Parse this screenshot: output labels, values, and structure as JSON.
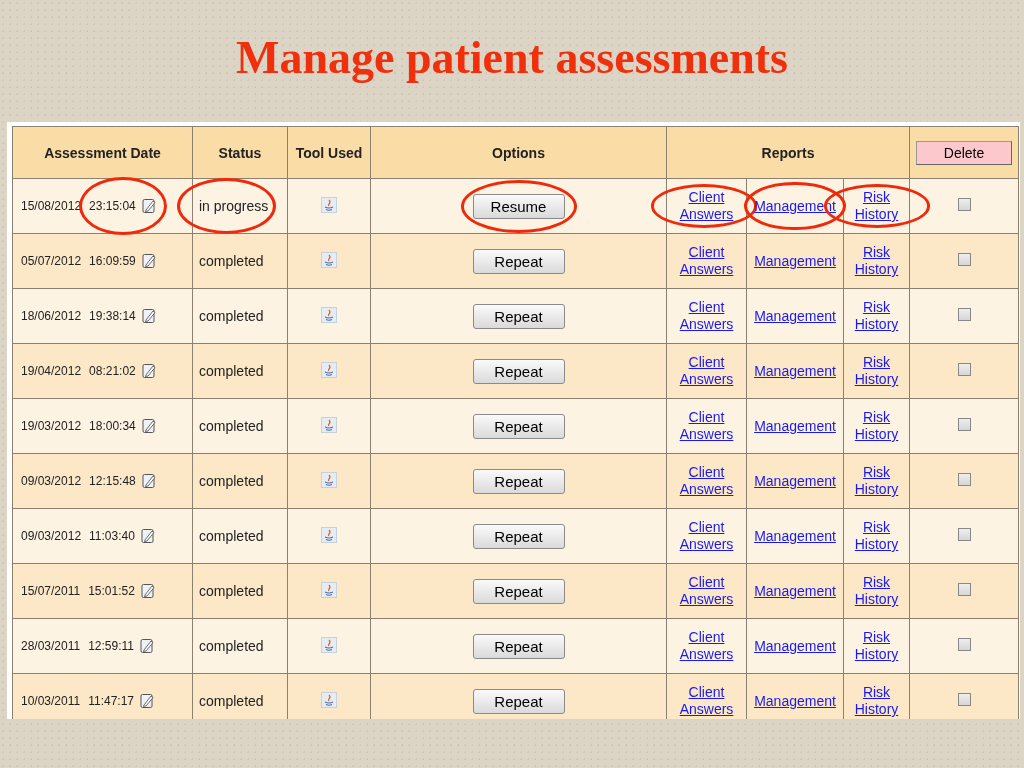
{
  "title": "Manage patient assessments",
  "columns": {
    "date": "Assessment Date",
    "status": "Status",
    "tool": "Tool Used",
    "options": "Options",
    "reports": "Reports",
    "delete": "Delete"
  },
  "rows": [
    {
      "date": "15/08/2012",
      "time": "23:15:04",
      "status": "in progress",
      "action": "Resume",
      "reports": [
        "Client Answers",
        "Management",
        "Risk History"
      ],
      "checked": false,
      "circled": true
    },
    {
      "date": "05/07/2012",
      "time": "16:09:59",
      "status": "completed",
      "action": "Repeat",
      "reports": [
        "Client Answers",
        "Management",
        "Risk History"
      ],
      "checked": false,
      "circled": false
    },
    {
      "date": "18/06/2012",
      "time": "19:38:14",
      "status": "completed",
      "action": "Repeat",
      "reports": [
        "Client Answers",
        "Management",
        "Risk History"
      ],
      "checked": false,
      "circled": false
    },
    {
      "date": "19/04/2012",
      "time": "08:21:02",
      "status": "completed",
      "action": "Repeat",
      "reports": [
        "Client Answers",
        "Management",
        "Risk History"
      ],
      "checked": false,
      "circled": false
    },
    {
      "date": "19/03/2012",
      "time": "18:00:34",
      "status": "completed",
      "action": "Repeat",
      "reports": [
        "Client Answers",
        "Management",
        "Risk History"
      ],
      "checked": false,
      "circled": false
    },
    {
      "date": "09/03/2012",
      "time": "12:15:48",
      "status": "completed",
      "action": "Repeat",
      "reports": [
        "Client Answers",
        "Management",
        "Risk History"
      ],
      "checked": false,
      "circled": false
    },
    {
      "date": "09/03/2012",
      "time": "11:03:40",
      "status": "completed",
      "action": "Repeat",
      "reports": [
        "Client Answers",
        "Management",
        "Risk History"
      ],
      "checked": false,
      "circled": false
    },
    {
      "date": "15/07/2011",
      "time": "15:01:52",
      "status": "completed",
      "action": "Repeat",
      "reports": [
        "Client Answers",
        "Management",
        "Risk History"
      ],
      "checked": false,
      "circled": false
    },
    {
      "date": "28/03/2011",
      "time": "12:59:11",
      "status": "completed",
      "action": "Repeat",
      "reports": [
        "Client Answers",
        "Management",
        "Risk History"
      ],
      "checked": false,
      "circled": false
    },
    {
      "date": "10/03/2011",
      "time": "11:47:17",
      "status": "completed",
      "action": "Repeat",
      "reports": [
        "Client Answers",
        "Management",
        "Risk History"
      ],
      "checked": false,
      "circled": false
    }
  ]
}
